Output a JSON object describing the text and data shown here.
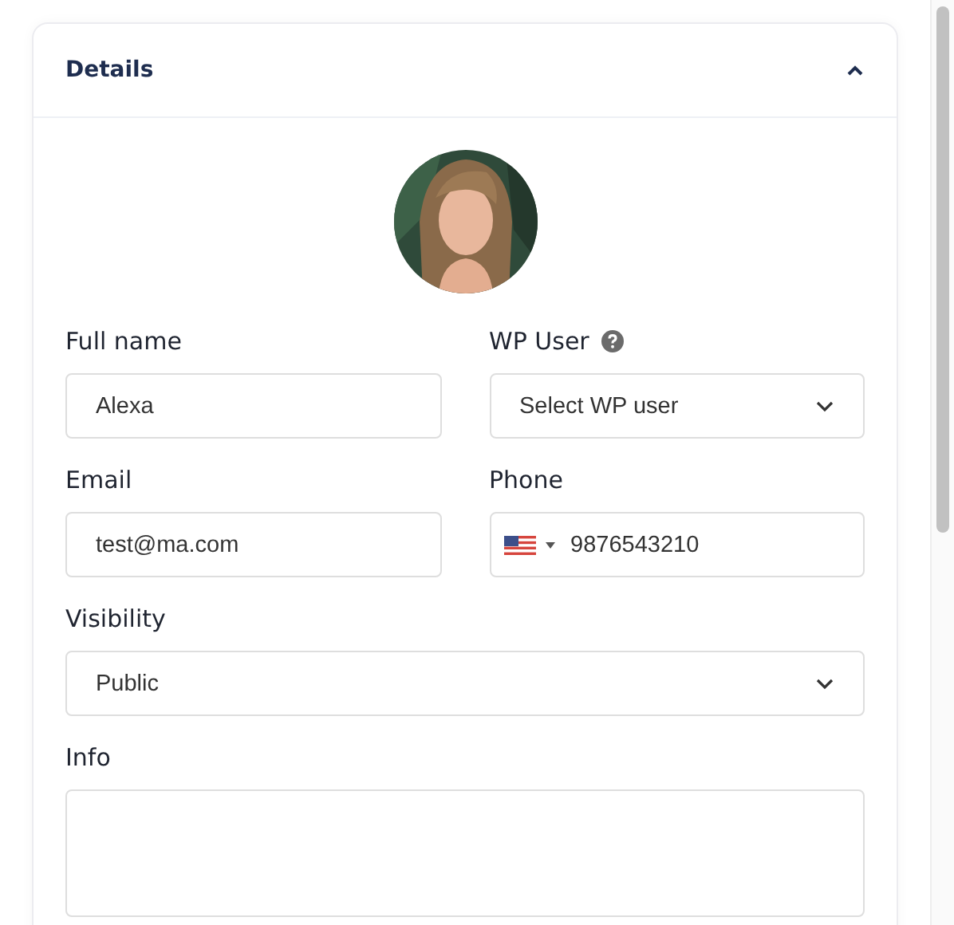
{
  "panel": {
    "title": "Details",
    "expanded": true
  },
  "fields": [
    {
      "label": "Full name",
      "kind": "text",
      "value": "Alexa",
      "help": false,
      "wide": false
    },
    {
      "label": "WP User",
      "kind": "select",
      "value": "Select WP user",
      "help": true,
      "wide": false
    },
    {
      "label": "Email",
      "kind": "text",
      "value": "test@ma.com",
      "help": false,
      "wide": false
    },
    {
      "label": "Phone",
      "kind": "phone",
      "value": "9876543210",
      "help": false,
      "wide": false
    },
    {
      "label": "Visibility",
      "kind": "select",
      "value": "Public",
      "help": false,
      "wide": true
    },
    {
      "label": "Info",
      "kind": "textarea",
      "help": false,
      "wide": true
    }
  ]
}
